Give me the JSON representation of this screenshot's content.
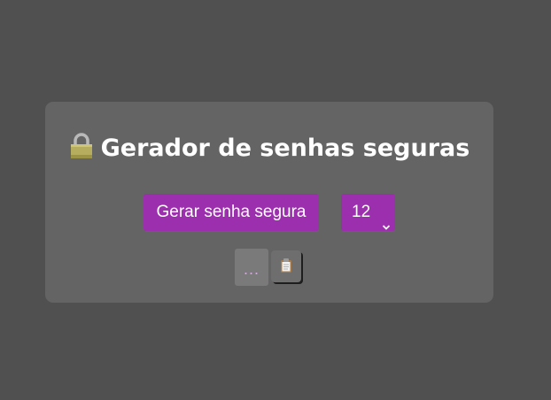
{
  "app": {
    "title": "Gerador de senhas seguras",
    "title_icon": "lock-icon"
  },
  "controls": {
    "generate_label": "Gerar senha segura",
    "length_selected": "12"
  },
  "output": {
    "password": "...",
    "copy_icon": "clipboard-icon"
  },
  "colors": {
    "background": "#505050",
    "card": "#646464",
    "accent": "#9c2fad",
    "title_text": "#ffffff",
    "password_text": "#e59cf0"
  }
}
